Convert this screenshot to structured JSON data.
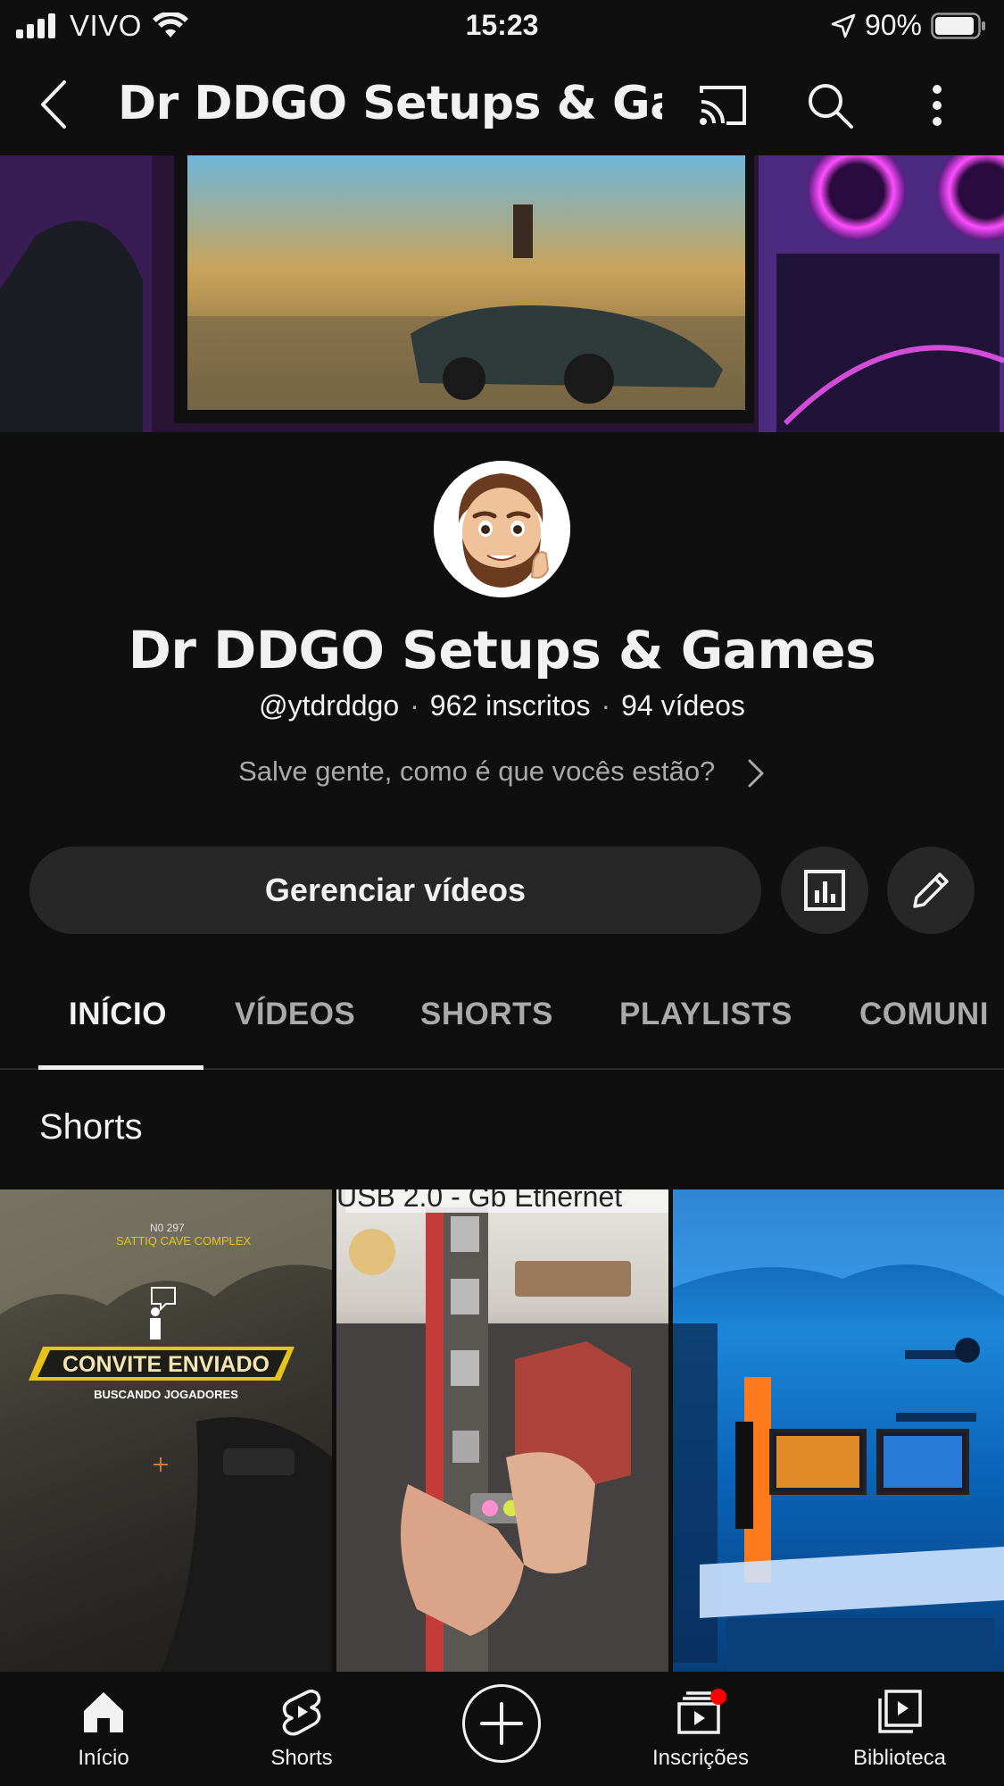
{
  "status_bar": {
    "carrier": "VIVO",
    "time": "15:23",
    "battery": "90%"
  },
  "app_bar": {
    "title": "Dr DDGO Setups & Ga..."
  },
  "channel": {
    "name": "Dr DDGO Setups & Games",
    "handle": "@ytdrddgo",
    "subscribers": "962 inscritos",
    "videos": "94 vídeos",
    "description": "Salve gente, como é que vocês estão?"
  },
  "actions": {
    "manage_label": "Gerenciar vídeos"
  },
  "tabs": [
    {
      "label": "INÍCIO",
      "active": true
    },
    {
      "label": "VÍDEOS",
      "active": false
    },
    {
      "label": "SHORTS",
      "active": false
    },
    {
      "label": "PLAYLISTS",
      "active": false
    },
    {
      "label": "COMUNI",
      "active": false
    }
  ],
  "section": {
    "title": "Shorts"
  },
  "shorts": [
    {
      "overlay_top": "SATTIQ CAVE COMPLEX",
      "overlay_code": "N0 297",
      "overlay_main": "CONVITE ENVIADO",
      "overlay_sub": "BUSCANDO JOGADORES"
    },
    {
      "overlay_top": "USB 2.0 - Gb Ethernet"
    },
    {}
  ],
  "bottom_nav": [
    {
      "label": "Início",
      "icon": "home-icon"
    },
    {
      "label": "Shorts",
      "icon": "shorts-icon"
    },
    {
      "label": "",
      "icon": "create-icon"
    },
    {
      "label": "Inscrições",
      "icon": "subscriptions-icon"
    },
    {
      "label": "Biblioteca",
      "icon": "library-icon"
    }
  ],
  "colors": {
    "background": "#0f0f0f",
    "button": "#272727",
    "muted_text": "#aaaaaa",
    "notification": "#ff0000"
  }
}
